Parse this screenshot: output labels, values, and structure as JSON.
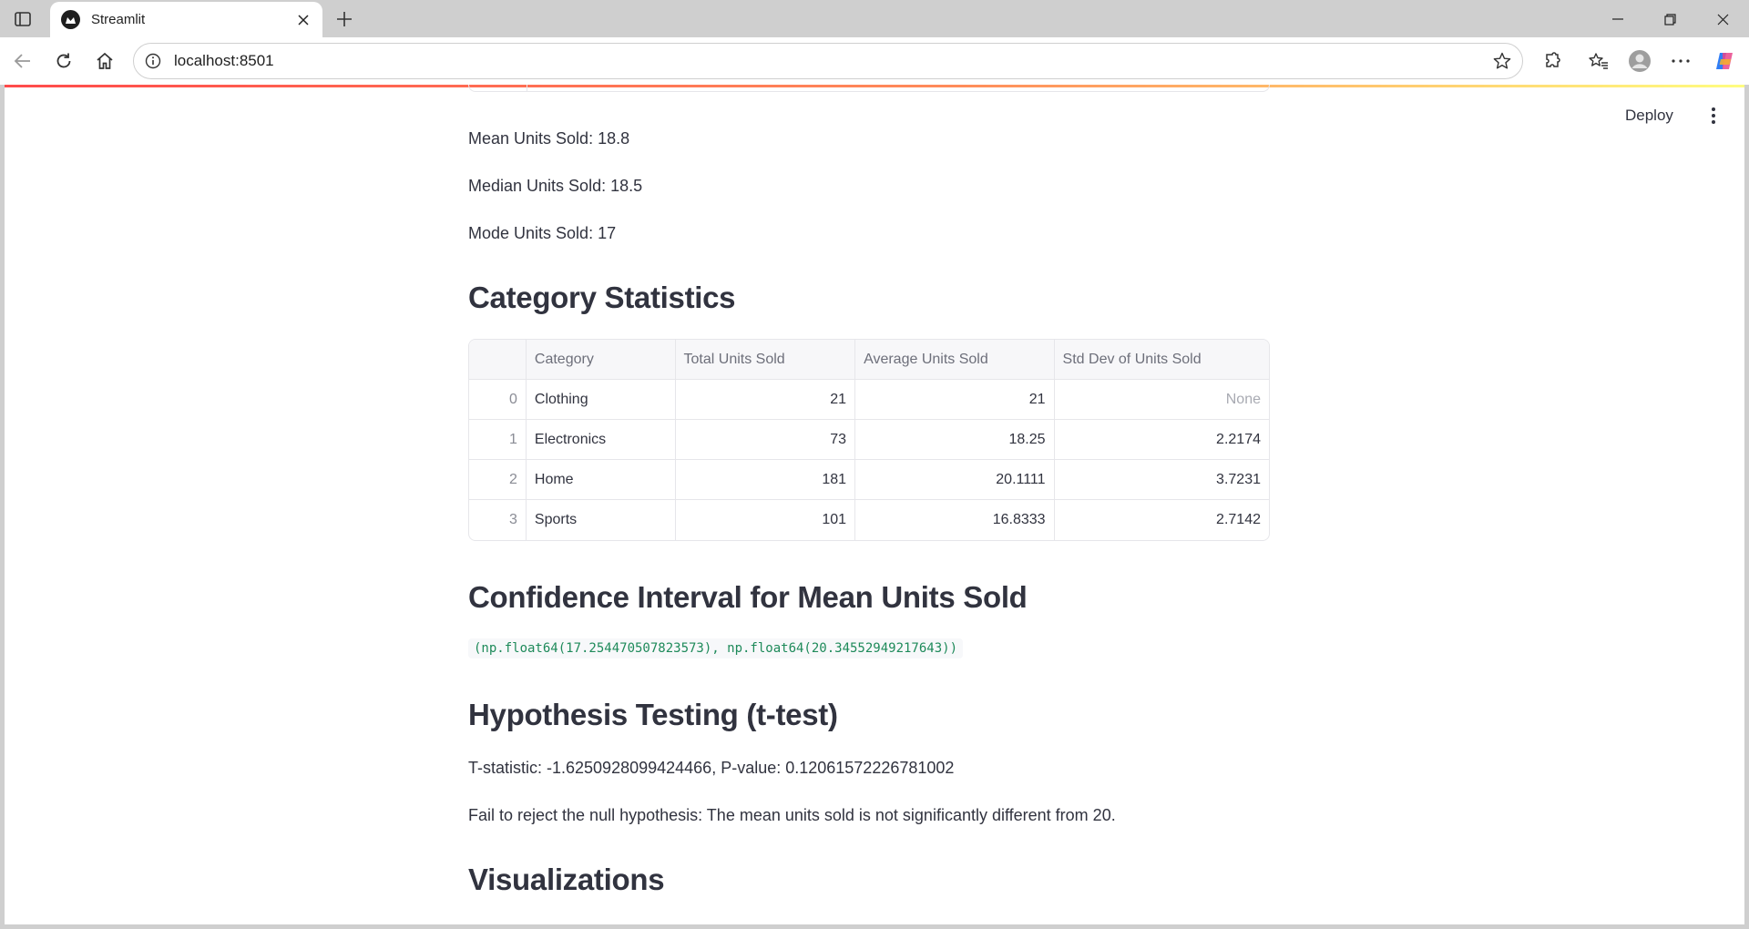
{
  "browser": {
    "tab_title": "Streamlit",
    "url": "localhost:8501"
  },
  "header": {
    "deploy_label": "Deploy"
  },
  "stats": {
    "mean": "Mean Units Sold: 18.8",
    "median": "Median Units Sold: 18.5",
    "mode": "Mode Units Sold: 17"
  },
  "category_section": {
    "heading": "Category Statistics",
    "columns": [
      "",
      "Category",
      "Total Units Sold",
      "Average Units Sold",
      "Std Dev of Units Sold"
    ],
    "rows": [
      {
        "index": "0",
        "category": "Clothing",
        "total": "21",
        "average": "21",
        "std": "None"
      },
      {
        "index": "1",
        "category": "Electronics",
        "total": "73",
        "average": "18.25",
        "std": "2.2174"
      },
      {
        "index": "2",
        "category": "Home",
        "total": "181",
        "average": "20.1111",
        "std": "3.7231"
      },
      {
        "index": "3",
        "category": "Sports",
        "total": "101",
        "average": "16.8333",
        "std": "2.7142"
      }
    ]
  },
  "confidence_section": {
    "heading": "Confidence Interval for Mean Units Sold",
    "output": "(np.float64(17.254470507823573), np.float64(20.34552949217643))"
  },
  "hypothesis_section": {
    "heading": "Hypothesis Testing (t-test)",
    "result": "T-statistic: -1.6250928099424466, P-value: 0.12061572226781002",
    "conclusion": "Fail to reject the null hypothesis: The mean units sold is not significantly different from 20."
  },
  "visualizations_section": {
    "heading": "Visualizations"
  },
  "colors": {
    "text": "#31333f",
    "code_text": "#1e8a5a",
    "accent_gradient_start": "#ff4b4b",
    "accent_gradient_end": "#fffd80"
  }
}
